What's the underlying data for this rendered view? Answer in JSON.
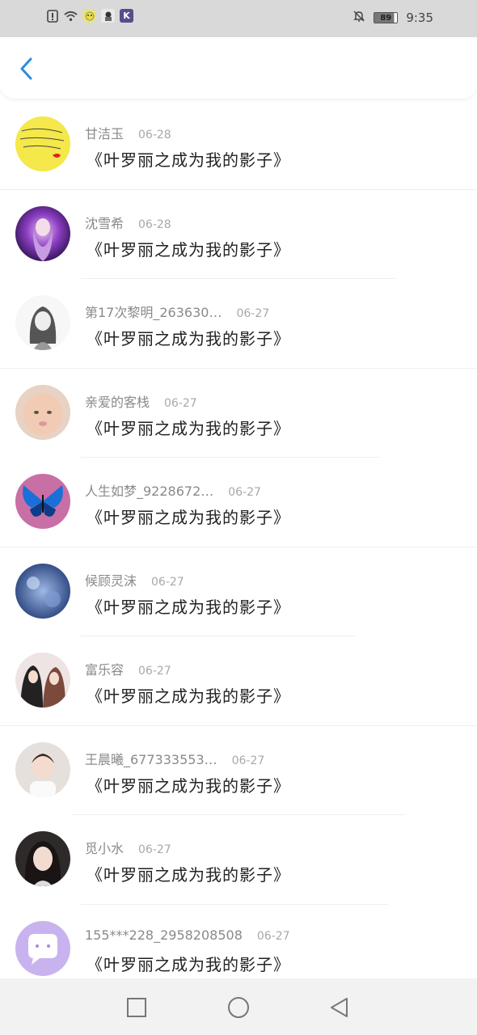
{
  "status_bar": {
    "icons": [
      "alert-icon",
      "wifi-icon",
      "app-icon-1",
      "app-icon-2",
      "app-icon-k"
    ],
    "battery": "89",
    "time": "9:35"
  },
  "header": {
    "back_icon": "chevron-left-icon"
  },
  "items": [
    {
      "name": "甘洁玉",
      "date": "06-28",
      "message": "《叶罗丽之成为我的影子》"
    },
    {
      "name": "沈雪希",
      "date": "06-28",
      "message": "《叶罗丽之成为我的影子》"
    },
    {
      "name": "第17次黎明_263630…",
      "date": "06-27",
      "message": "《叶罗丽之成为我的影子》"
    },
    {
      "name": "亲爱的客栈",
      "date": "06-27",
      "message": "《叶罗丽之成为我的影子》"
    },
    {
      "name": "人生如梦_9228672…",
      "date": "06-27",
      "message": "《叶罗丽之成为我的影子》"
    },
    {
      "name": "候顾灵沫",
      "date": "06-27",
      "message": "《叶罗丽之成为我的影子》"
    },
    {
      "name": "富乐容",
      "date": "06-27",
      "message": "《叶罗丽之成为我的影子》"
    },
    {
      "name": "王晨曦_677333553…",
      "date": "06-27",
      "message": "《叶罗丽之成为我的影子》"
    },
    {
      "name": "觅小水",
      "date": "06-27",
      "message": "《叶罗丽之成为我的影子》"
    },
    {
      "name": "155***228_2958208508",
      "date": "06-27",
      "message": "《叶罗丽之成为我的影子》"
    }
  ],
  "colors": {
    "accent": "#2a8de0",
    "status_bar": "#d9d9d9",
    "nav_bar": "#f2f2f2"
  }
}
